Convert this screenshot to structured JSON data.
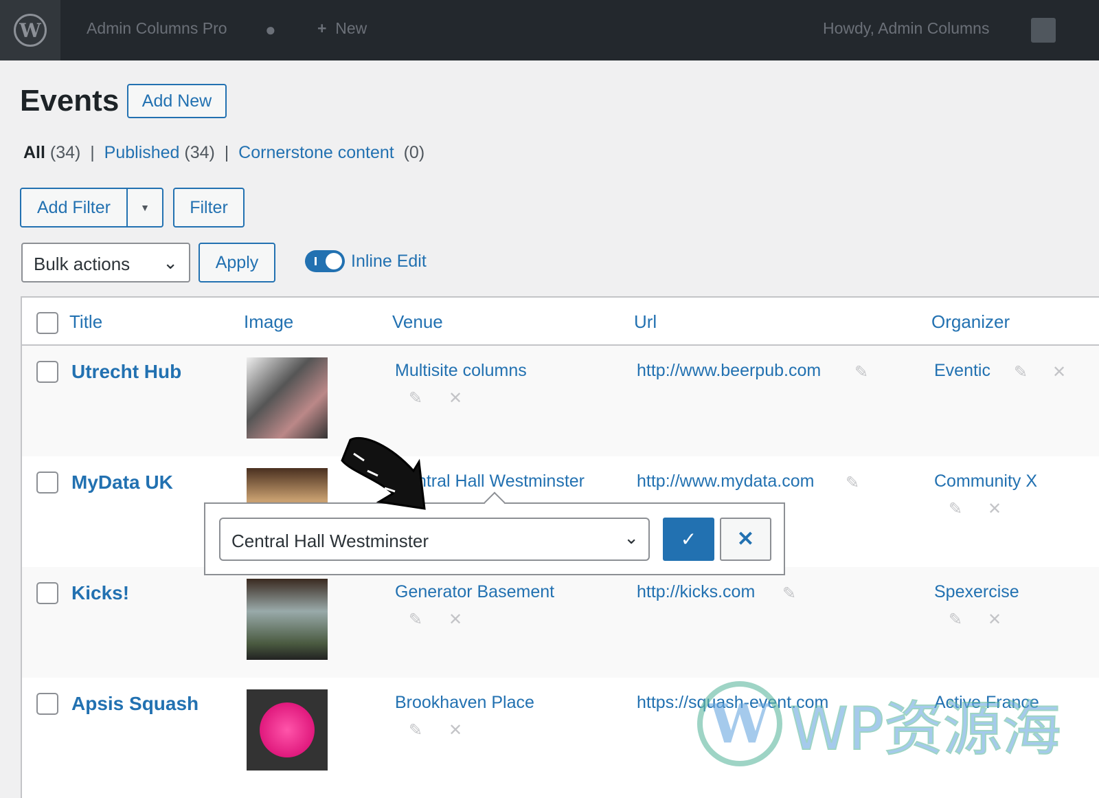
{
  "topbar": {
    "site": "Admin Columns Pro",
    "new": "New",
    "howdy": "Howdy, Admin Columns"
  },
  "page": {
    "title": "Events",
    "add_new": "Add New"
  },
  "views": [
    {
      "label": "All",
      "count": "(34)"
    },
    {
      "label": "Published",
      "count": "(34)"
    },
    {
      "label": "Cornerstone content",
      "count": "(0)"
    }
  ],
  "filters": {
    "add_filter": "Add Filter",
    "filter": "Filter",
    "bulk": "Bulk actions",
    "apply": "Apply",
    "inline_edit": "Inline Edit",
    "inline_edit_on": true
  },
  "columns": [
    "Title",
    "Image",
    "Venue",
    "Url",
    "Organizer"
  ],
  "rows": [
    {
      "title": "Utrecht Hub",
      "venue": "Multisite columns",
      "url": "http://www.beerpub.com",
      "organizer": "Eventic"
    },
    {
      "title": "MyData UK",
      "venue": "Central Hall Westminster",
      "url": "http://www.mydata.com",
      "organizer": "Community X"
    },
    {
      "title": "Kicks!",
      "venue": "Generator Basement",
      "url": "http://kicks.com",
      "organizer": "Spexercise"
    },
    {
      "title": "Apsis Squash",
      "venue": "Brookhaven Place",
      "url": "https://squash-event.com",
      "organizer": "Active France"
    }
  ],
  "inline_editor": {
    "value": "Central Hall Westminster"
  },
  "watermark": "WP资源海",
  "colors": {
    "accent": "#2271b1",
    "topbar": "#23282d"
  }
}
